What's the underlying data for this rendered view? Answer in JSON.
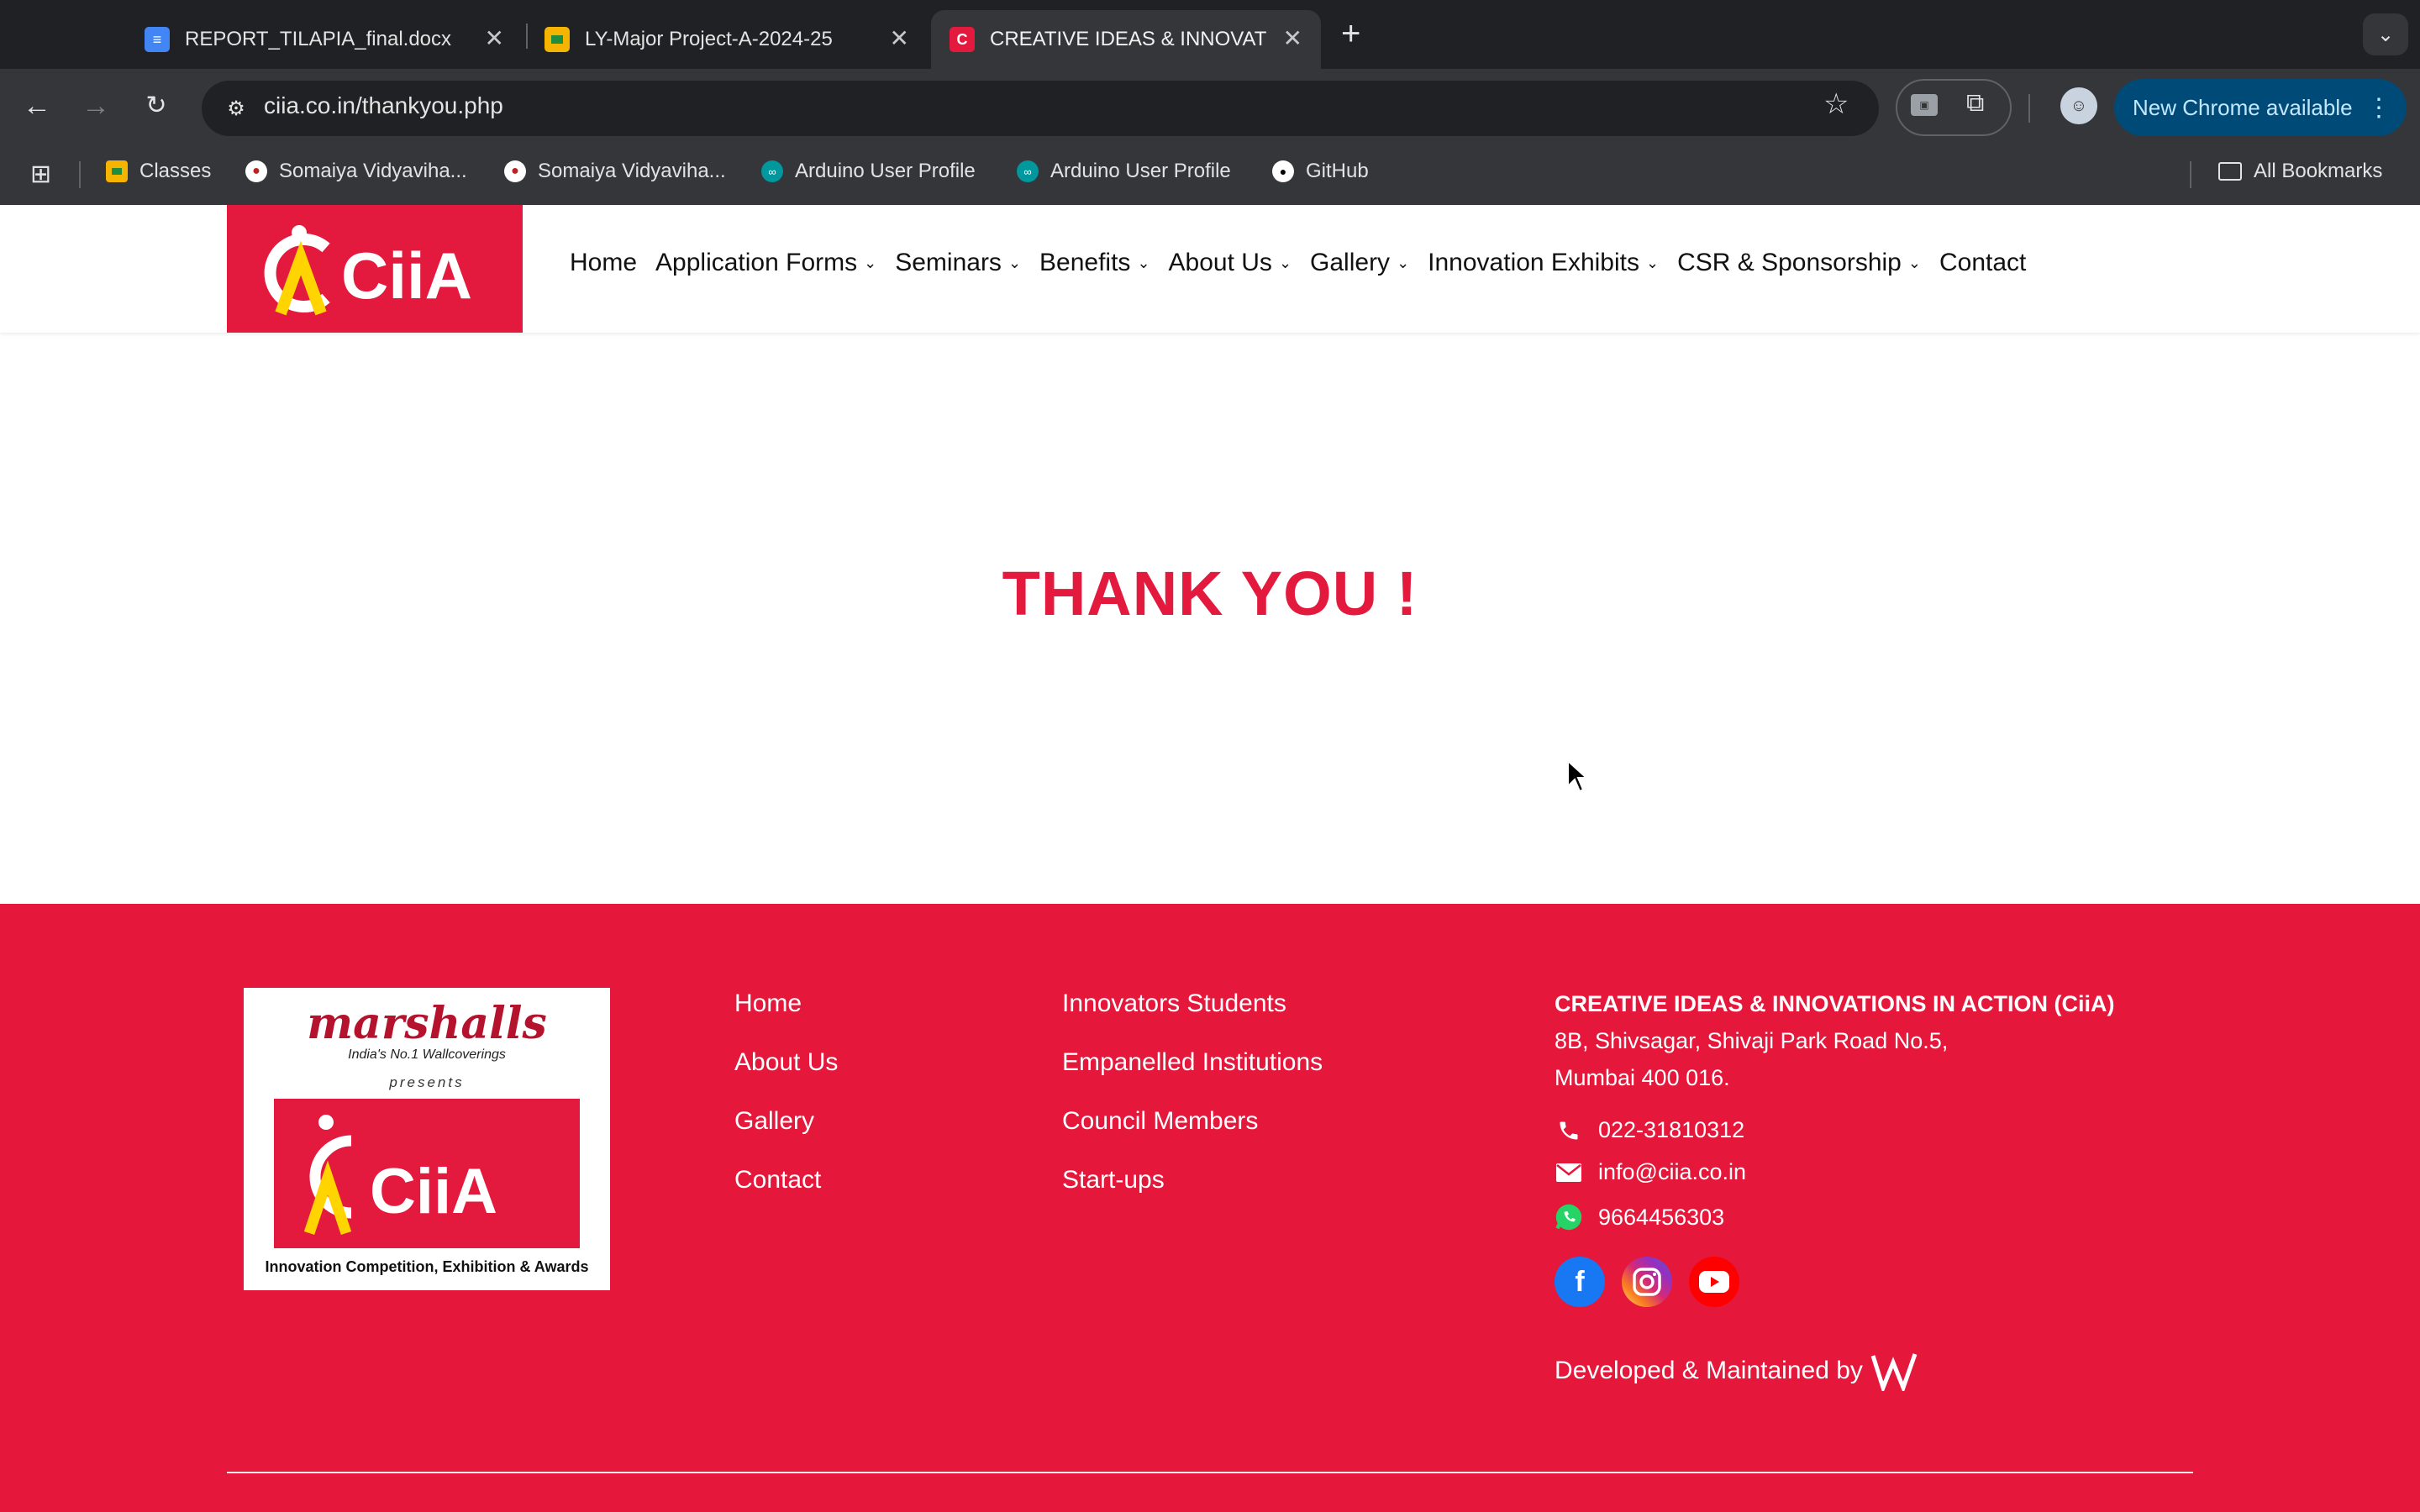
{
  "browser": {
    "tabs": [
      {
        "title": "REPORT_TILAPIA_final.docx",
        "icon": "google-docs-icon",
        "active": false
      },
      {
        "title": "LY-Major Project-A-2024-25",
        "icon": "google-classroom-icon",
        "active": false
      },
      {
        "title": "CREATIVE IDEAS & INNOVATI",
        "icon": "ciia-favicon-icon",
        "active": true
      }
    ],
    "url": "ciia.co.in/thankyou.php",
    "update_button": "New Chrome available",
    "bookmarks": [
      {
        "label": "Classes",
        "icon": "google-classroom-icon"
      },
      {
        "label": "Somaiya Vidyaviha...",
        "icon": "somaiya-icon"
      },
      {
        "label": "Somaiya Vidyaviha...",
        "icon": "somaiya-icon"
      },
      {
        "label": "Arduino User Profile",
        "icon": "arduino-icon"
      },
      {
        "label": "Arduino User Profile",
        "icon": "arduino-icon"
      },
      {
        "label": "GitHub",
        "icon": "github-icon"
      }
    ],
    "all_bookmarks": "All Bookmarks"
  },
  "site": {
    "logo_text": "CiiA",
    "nav": [
      {
        "label": "Home",
        "dropdown": false
      },
      {
        "label": "Application Forms",
        "dropdown": true
      },
      {
        "label": "Seminars",
        "dropdown": true
      },
      {
        "label": "Benefits",
        "dropdown": true
      },
      {
        "label": "About Us",
        "dropdown": true
      },
      {
        "label": "Gallery",
        "dropdown": true
      },
      {
        "label": "Innovation Exhibits",
        "dropdown": true
      },
      {
        "label": "CSR & Sponsorship",
        "dropdown": true
      },
      {
        "label": "Contact",
        "dropdown": false
      }
    ],
    "heading": "THANK YOU !",
    "colors": {
      "brand_red": "#e31a3d",
      "logo_yellow": "#ffd400"
    }
  },
  "footer": {
    "sponsor_logo": {
      "brand": "marshalls",
      "tagline": "India's No.1 Wallcoverings",
      "presents": "presents",
      "ciia": "CiiA",
      "subtitle": "Innovation Competition, Exhibition & Awards"
    },
    "links_col1": [
      "Home",
      "About Us",
      "Gallery",
      "Contact"
    ],
    "links_col2": [
      "Innovators Students",
      "Empanelled Institutions",
      "Council Members",
      "Start-ups"
    ],
    "org_name": "CREATIVE IDEAS & INNOVATIONS IN ACTION (CiiA)",
    "address_line1": "8B, Shivsagar, Shivaji Park Road No.5,",
    "address_line2": "Mumbai 400 016.",
    "phone": "022-31810312",
    "email": "info@ciia.co.in",
    "whatsapp": "9664456303",
    "social": [
      "facebook-icon",
      "instagram-icon",
      "youtube-icon"
    ],
    "developed_by": "Developed & Maintained by"
  }
}
